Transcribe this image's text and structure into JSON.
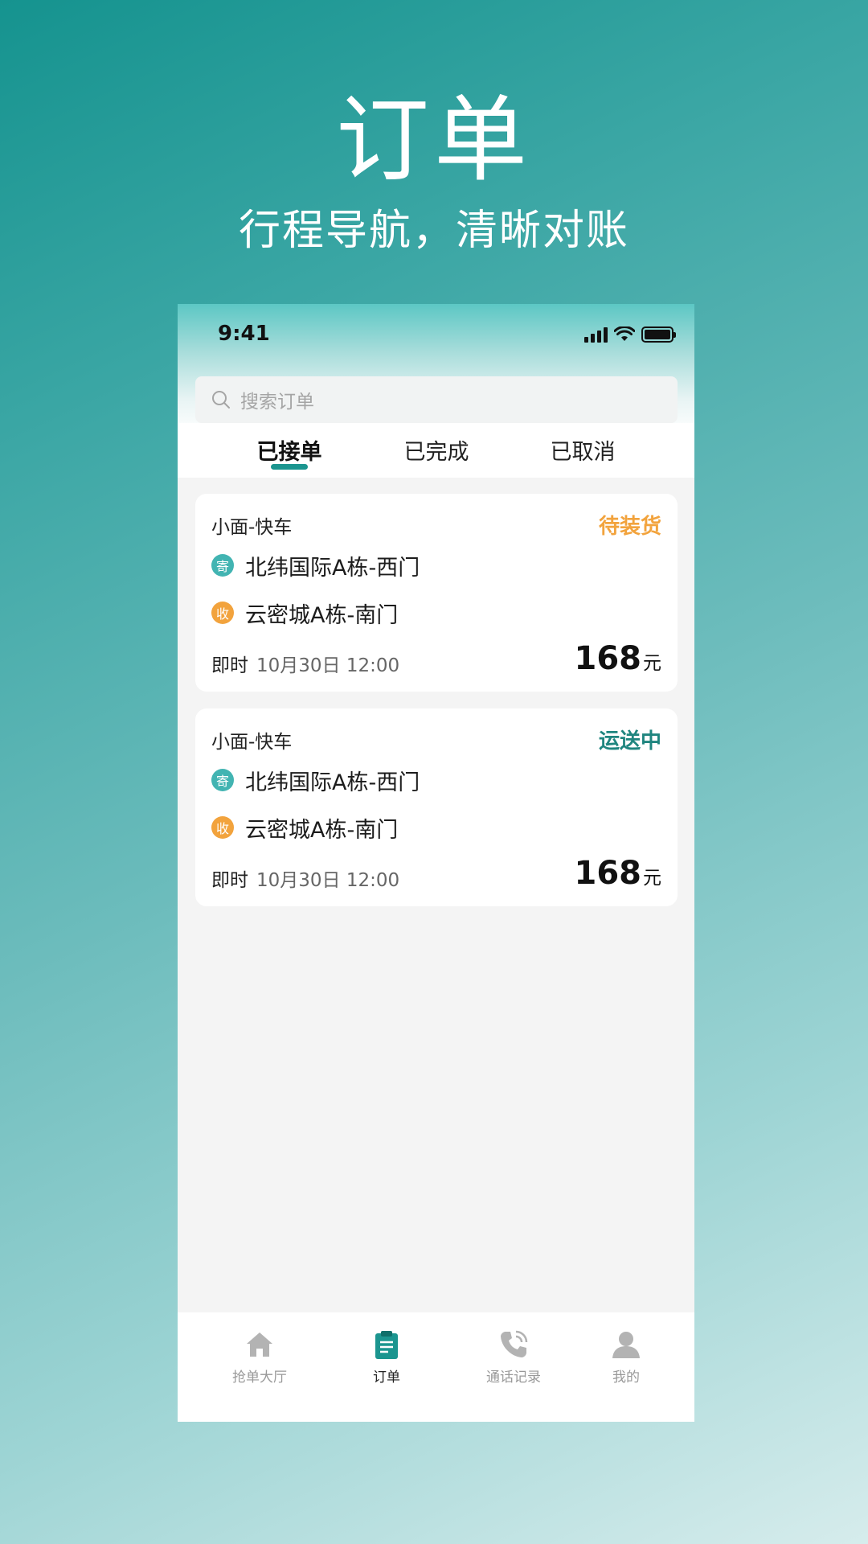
{
  "hero": {
    "title": "订单",
    "subtitle": "行程导航，清晰对账"
  },
  "status_bar": {
    "time": "9:41"
  },
  "search": {
    "placeholder": "搜索订单"
  },
  "tabs": [
    {
      "label": "已接单",
      "active": true
    },
    {
      "label": "已完成",
      "active": false
    },
    {
      "label": "已取消",
      "active": false
    }
  ],
  "orders": [
    {
      "vehicle": "小面-快车",
      "status": "待装货",
      "status_color": "#f2a33d",
      "send_badge": "寄",
      "from": "北纬国际A栋-西门",
      "recv_badge": "收",
      "to": "云密城A栋-南门",
      "time_type": "即时",
      "datetime": "10月30日 12:00",
      "price": "168",
      "unit": "元"
    },
    {
      "vehicle": "小面-快车",
      "status": "运送中",
      "status_color": "#1f857f",
      "send_badge": "寄",
      "from": "北纬国际A栋-西门",
      "recv_badge": "收",
      "to": "云密城A栋-南门",
      "time_type": "即时",
      "datetime": "10月30日 12:00",
      "price": "168",
      "unit": "元"
    }
  ],
  "bottom_nav": [
    {
      "label": "抢单大厅",
      "icon": "home-icon",
      "active": false
    },
    {
      "label": "订单",
      "icon": "clipboard-icon",
      "active": true
    },
    {
      "label": "通话记录",
      "icon": "phone-call-icon",
      "active": false
    },
    {
      "label": "我的",
      "icon": "user-icon",
      "active": false
    }
  ],
  "colors": {
    "accent": "#1b958f",
    "pending": "#f2a33d",
    "in_transit": "#1f857f"
  }
}
